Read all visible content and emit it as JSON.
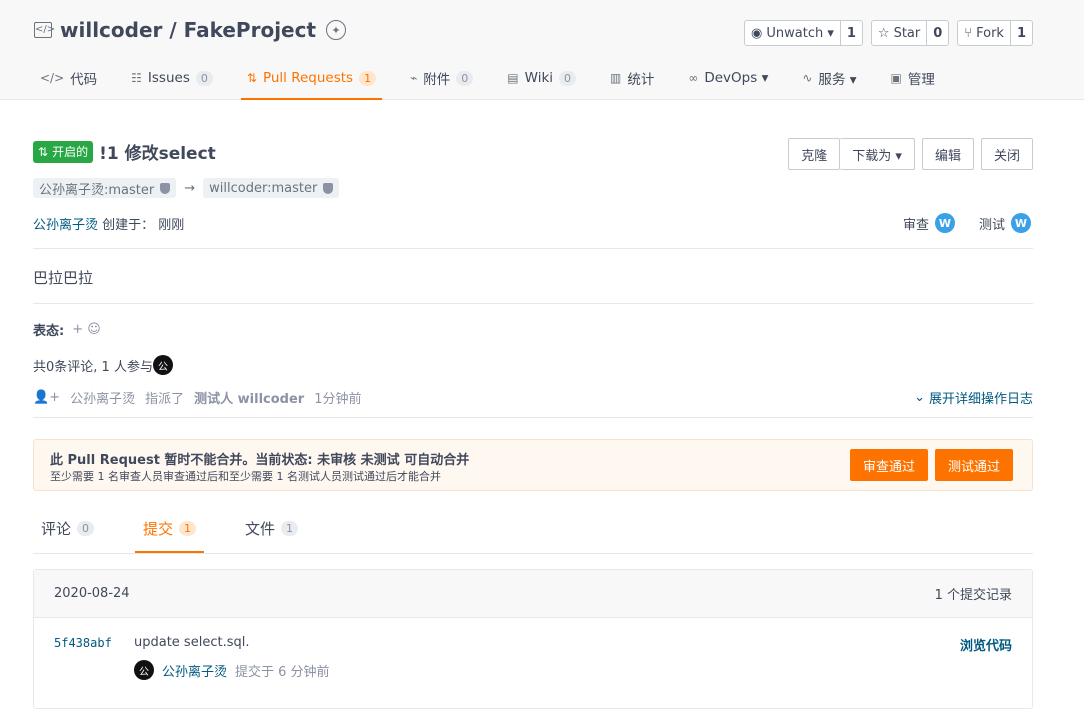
{
  "repo": {
    "title": "willcoder / FakeProject",
    "actions": [
      {
        "icon": "eye-icon",
        "label": "Unwatch ▾",
        "count": "1"
      },
      {
        "icon": "star-icon",
        "label": "Star",
        "count": "0"
      },
      {
        "icon": "fork-icon",
        "label": "Fork",
        "count": "1"
      }
    ]
  },
  "tabs": [
    {
      "icon": "code-icon",
      "label": "代码",
      "count": null
    },
    {
      "icon": "issues-icon",
      "label": "Issues",
      "count": "0"
    },
    {
      "icon": "pull-request-icon",
      "label": "Pull Requests",
      "count": "1",
      "active": true
    },
    {
      "icon": "attachment-icon",
      "label": "附件",
      "count": "0"
    },
    {
      "icon": "wiki-icon",
      "label": "Wiki",
      "count": "0"
    },
    {
      "icon": "stats-icon",
      "label": "统计",
      "count": null
    },
    {
      "icon": "devops-icon",
      "label": "DevOps ▾",
      "count": null
    },
    {
      "icon": "service-icon",
      "label": "服务 ▾",
      "count": null
    },
    {
      "icon": "manage-icon",
      "label": "管理",
      "count": null
    }
  ],
  "pr": {
    "state": "开启的",
    "title": "!1 修改select",
    "buttons": {
      "clone": "克隆",
      "download": "下载为 ▾",
      "edit": "编辑",
      "close": "关闭"
    },
    "source_branch": "公孙离子烫:master",
    "target_branch": "willcoder:master",
    "creator": "公孙离子烫",
    "created_text": "创建于：  刚刚",
    "reviewers": [
      {
        "label": "审查",
        "avatar": "W"
      },
      {
        "label": "测试",
        "avatar": "W"
      }
    ],
    "body": "巴拉巴拉",
    "reactions_label": "表态:",
    "reactions_add": "+ ☺",
    "participants_text": "共0条评论, 1 人参与",
    "participant_avatar": "公",
    "activity": {
      "user": "公孙离子烫",
      "verb": "指派了",
      "target": "测试人 willcoder",
      "time": "1分钟前"
    },
    "expand_log": "展开详细操作日志"
  },
  "merge": {
    "line1": "此 Pull Request 暂时不能合并。当前状态: 未审核 未测试 可自动合并",
    "line2": "至少需要 1 名审查人员审查通过后和至少需要 1 名测试人员测试通过后才能合并",
    "approve_review": "审查通过",
    "approve_test": "测试通过"
  },
  "subtabs": [
    {
      "label": "评论",
      "count": "0"
    },
    {
      "label": "提交",
      "count": "1",
      "active": true
    },
    {
      "label": "文件",
      "count": "1"
    }
  ],
  "commits": {
    "date": "2020-08-24",
    "summary": "1 个提交记录",
    "items": [
      {
        "sha": "5f438abf",
        "message": "update select.sql.",
        "browse": "浏览代码",
        "avatar": "公",
        "author": "公孙离子烫",
        "time": "提交于 6 分钟前"
      }
    ]
  },
  "colors": {
    "accent": "#fe7300",
    "link": "#005980",
    "success": "#28a745"
  }
}
